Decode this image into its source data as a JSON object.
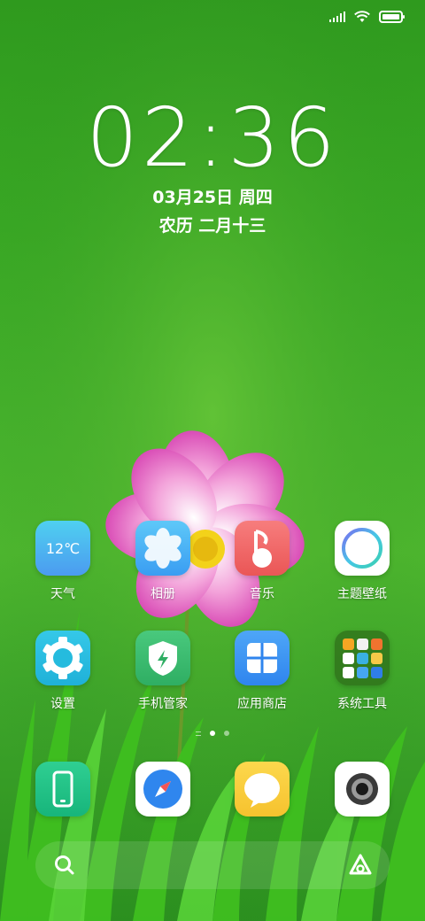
{
  "status_bar": {
    "icons": [
      "signal-icon",
      "wifi-icon",
      "battery-icon"
    ]
  },
  "lockclock": {
    "time": "02:36",
    "date": "03月25日 周四",
    "lunar": "农历 二月十三"
  },
  "apps_row1": [
    {
      "label": "天气",
      "icon": "weather-icon",
      "temp": "12℃"
    },
    {
      "label": "相册",
      "icon": "gallery-icon"
    },
    {
      "label": "音乐",
      "icon": "music-icon"
    },
    {
      "label": "主题壁纸",
      "icon": "theme-icon"
    }
  ],
  "apps_row2": [
    {
      "label": "设置",
      "icon": "settings-icon"
    },
    {
      "label": "手机管家",
      "icon": "security-icon"
    },
    {
      "label": "应用商店",
      "icon": "app-store-icon"
    },
    {
      "label": "系统工具",
      "icon": "folder-icon"
    }
  ],
  "dock": [
    {
      "icon": "phone-icon"
    },
    {
      "icon": "browser-icon"
    },
    {
      "icon": "messages-icon"
    },
    {
      "icon": "camera-icon"
    }
  ],
  "colors": {
    "wallpaper": "#3ea52a",
    "flower": "#e06bc4",
    "music": "#f06a6a",
    "store": "#3b8df0",
    "security": "#3bb56a"
  }
}
